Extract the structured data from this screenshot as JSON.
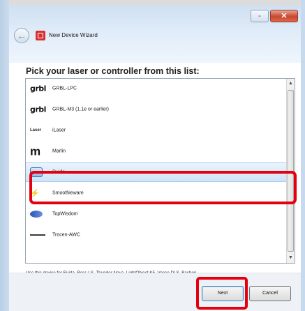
{
  "window": {
    "title": "New Device Wizard",
    "controls": {
      "minimize": "-",
      "maximize": "□",
      "close": "✕"
    }
  },
  "content": {
    "heading": "Pick your laser or controller from this list:",
    "items": [
      {
        "logo": "grbl",
        "label": "GRBL-LPC",
        "icon": "grbl-logo-icon"
      },
      {
        "logo": "grbl",
        "label": "GRBL-M3 (1.1e or earlier)",
        "icon": "grbl-logo-icon"
      },
      {
        "logo": "Laser",
        "label": "iLaser",
        "icon": "laser-logo-icon"
      },
      {
        "logo": "m",
        "label": "Marlin",
        "icon": "marlin-logo-icon"
      },
      {
        "logo": "",
        "label": "Ruida",
        "icon": "ruida-logo-icon",
        "selected": true
      },
      {
        "logo": "⚡",
        "label": "Smoothieware",
        "icon": "smoothieware-logo-icon"
      },
      {
        "logo": "",
        "label": "TopWisdom",
        "icon": "topwisdom-logo-icon"
      },
      {
        "logo": "",
        "label": "Trocen-AWC",
        "icon": "trocen-logo-icon"
      }
    ],
    "description": "Use this device for Ruida, Boss LS, Thunder Nova, LightObject K5, Vocco DLS, Bashen"
  },
  "footer": {
    "next_label": "Next",
    "cancel_label": "Cancel"
  },
  "colors": {
    "highlight": "#e4000f",
    "selection": "#cfe3f7"
  }
}
